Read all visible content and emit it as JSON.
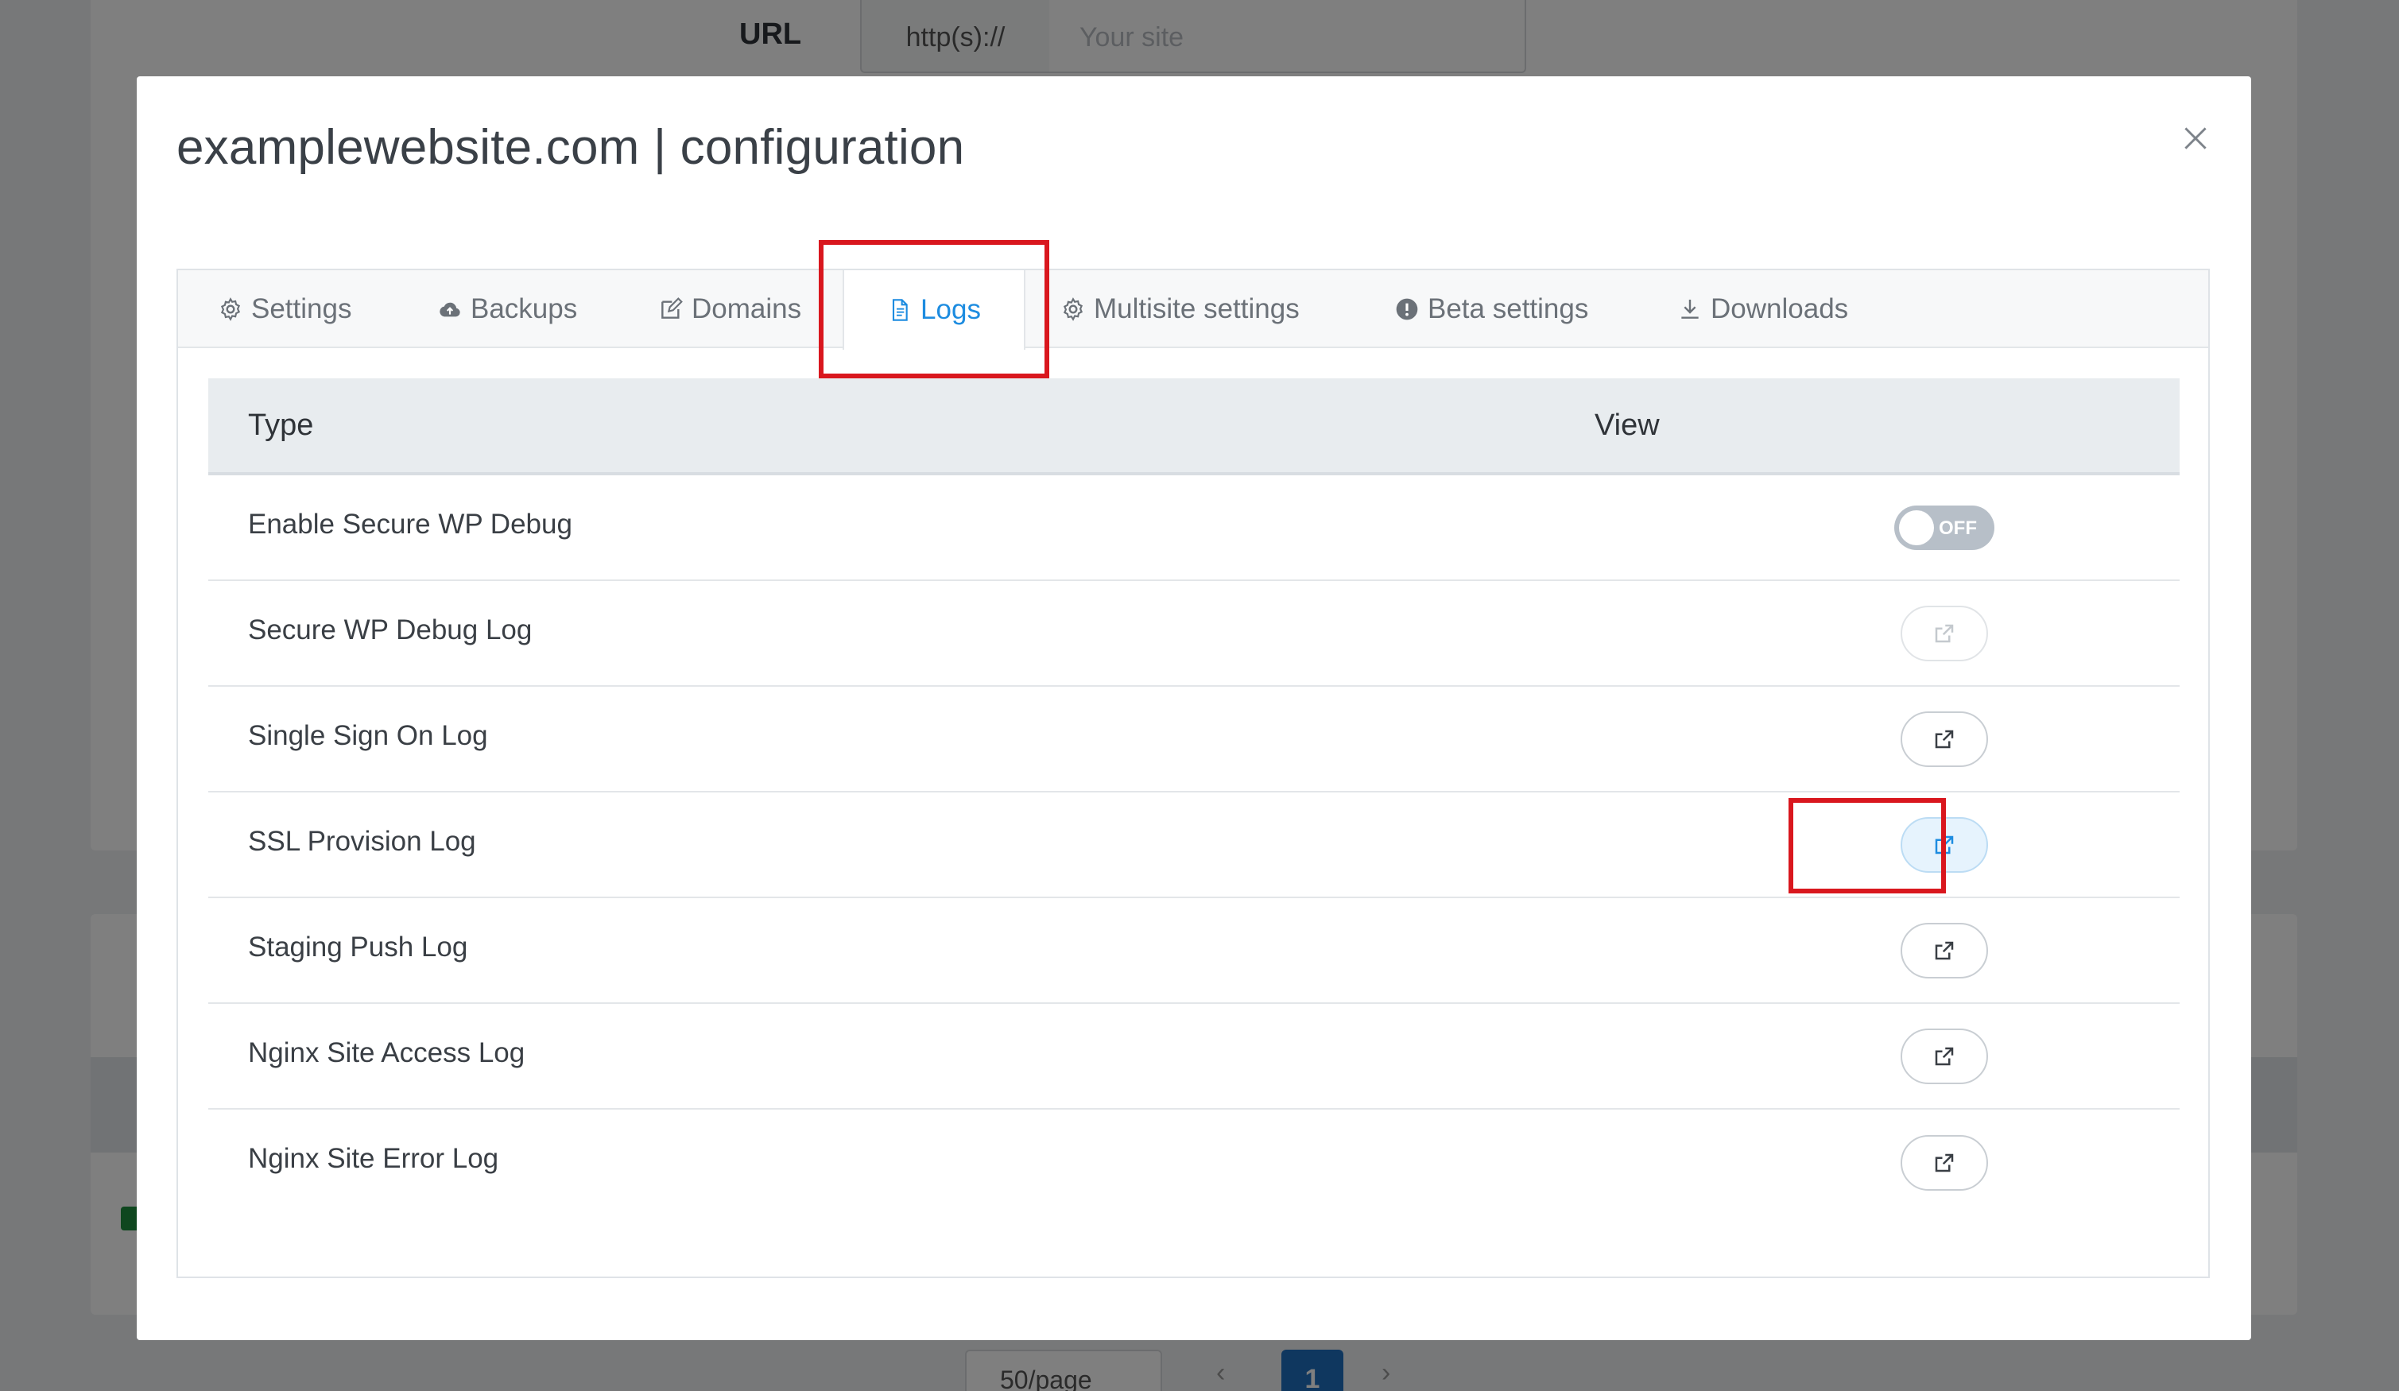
{
  "background": {
    "url_label": "URL",
    "url_prefix": "http(s)://",
    "url_placeholder": "Your site",
    "pager_size": "50/page",
    "pager_current": "1"
  },
  "modal": {
    "title": "examplewebsite.com | configuration",
    "tabs": [
      {
        "label": "Settings",
        "icon": "gear-icon"
      },
      {
        "label": "Backups",
        "icon": "cloud-icon"
      },
      {
        "label": "Domains",
        "icon": "edit-icon"
      },
      {
        "label": "Logs",
        "icon": "document-icon",
        "active": true
      },
      {
        "label": "Multisite settings",
        "icon": "gear-icon"
      },
      {
        "label": "Beta settings",
        "icon": "exclamation-circle-icon"
      },
      {
        "label": "Downloads",
        "icon": "download-icon"
      }
    ],
    "table": {
      "col_type": "Type",
      "col_view": "View",
      "rows": [
        {
          "label": "Enable Secure WP Debug",
          "control": "toggle",
          "state": "OFF"
        },
        {
          "label": "Secure WP Debug Log",
          "control": "external-link",
          "disabled": true
        },
        {
          "label": "Single Sign On Log",
          "control": "external-link"
        },
        {
          "label": "SSL Provision Log",
          "control": "external-link",
          "highlighted": true
        },
        {
          "label": "Staging Push Log",
          "control": "external-link"
        },
        {
          "label": "Nginx Site Access Log",
          "control": "external-link"
        },
        {
          "label": "Nginx Site Error Log",
          "control": "external-link"
        }
      ]
    }
  },
  "colors": {
    "accent": "#1d8ce0",
    "highlight_box": "#d9171e",
    "toggle_off": "#b7bfc8",
    "table_header": "#e8ecef"
  }
}
